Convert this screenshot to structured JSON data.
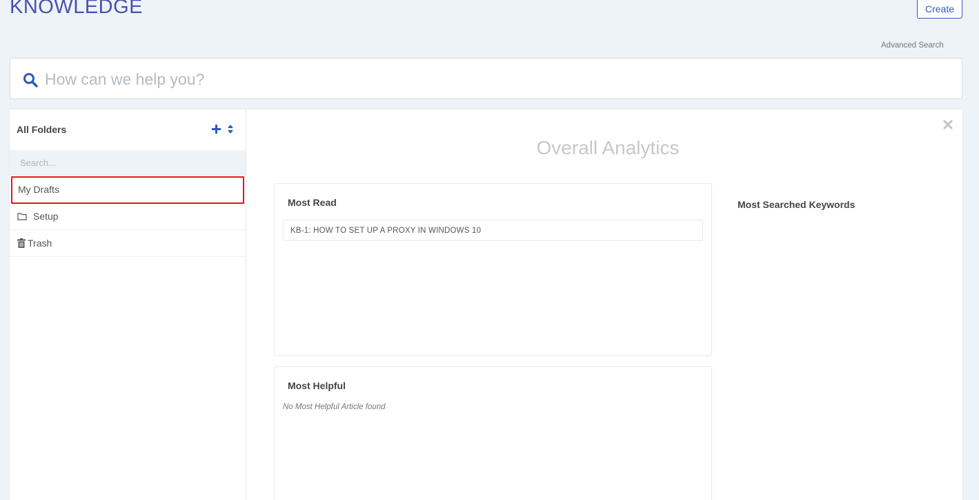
{
  "header": {
    "title": "KNOWLEDGE",
    "create_label": "Create",
    "advanced_search_label": "Advanced Search"
  },
  "search": {
    "placeholder": "How can we help you?",
    "icon": "search-icon"
  },
  "sidebar": {
    "title": "All Folders",
    "search_placeholder": "Search...",
    "items": [
      {
        "label": "My Drafts",
        "icon": ""
      },
      {
        "label": "Setup",
        "icon": "folder-icon"
      },
      {
        "label": "Trash",
        "icon": "trash-icon"
      }
    ]
  },
  "analytics": {
    "title": "Overall Analytics",
    "most_read": {
      "title": "Most Read",
      "articles": [
        "KB-1: HOW TO SET UP A PROXY IN WINDOWS 10"
      ]
    },
    "most_helpful": {
      "title": "Most Helpful",
      "empty_text": "No Most Helpful Article found"
    },
    "most_searched": {
      "title": "Most Searched Keywords"
    }
  },
  "colors": {
    "accent": "#2a5cb8",
    "title": "#4b4fb0",
    "highlight": "#e01818",
    "background": "#eef3f7"
  }
}
